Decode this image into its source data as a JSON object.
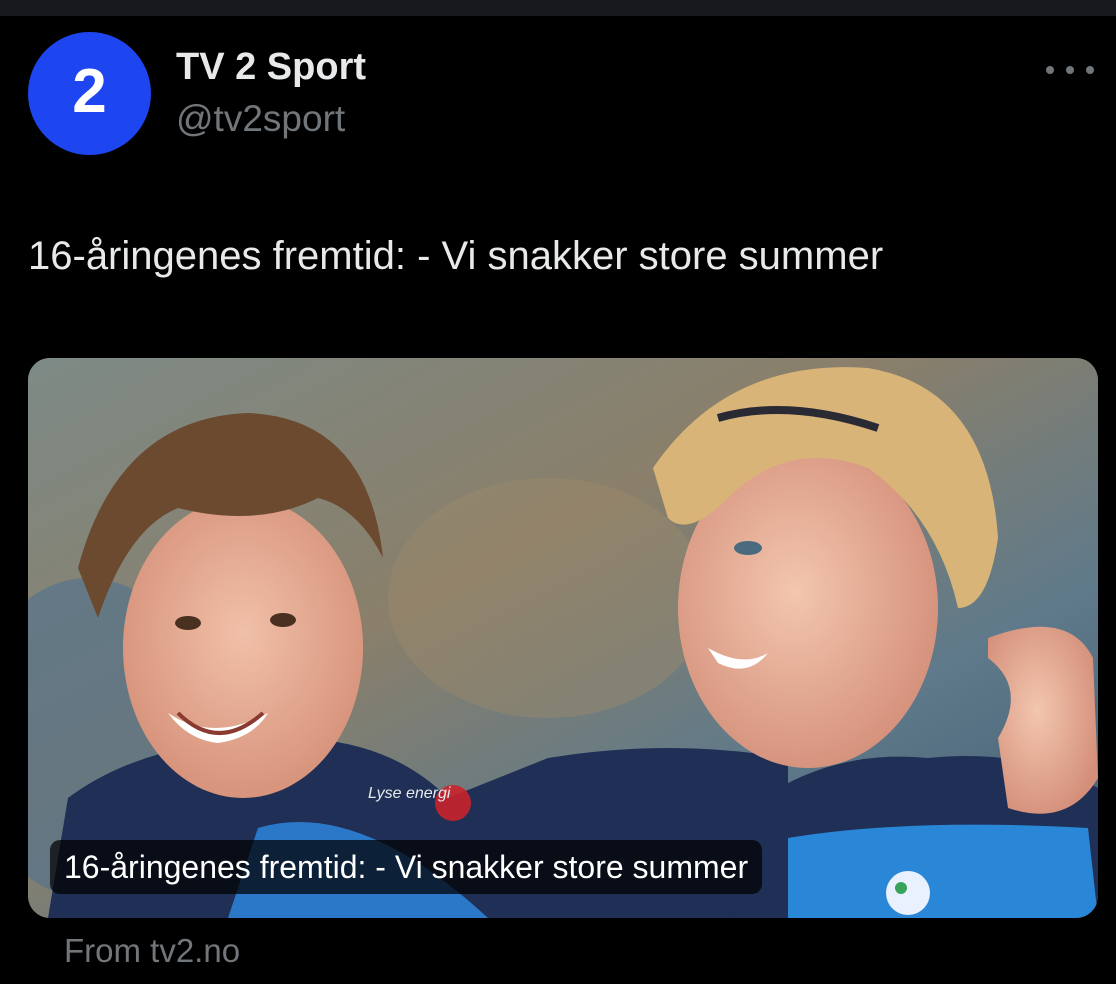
{
  "account": {
    "avatar_text": "2",
    "display_name": "TV 2 Sport",
    "handle": "@tv2sport",
    "avatar_color": "#1e46f0"
  },
  "tweet": {
    "text": "16-åringenes fremtid: - Vi snakker store summer"
  },
  "card": {
    "caption": "16-åringenes fremtid: - Vi snakker store summer",
    "source": "From tv2.no",
    "shirt_text_left": "Lyse energi",
    "image_description_icon": "photo-of-two-smiling-football-players"
  },
  "icons": {
    "more": "more-options-icon"
  }
}
